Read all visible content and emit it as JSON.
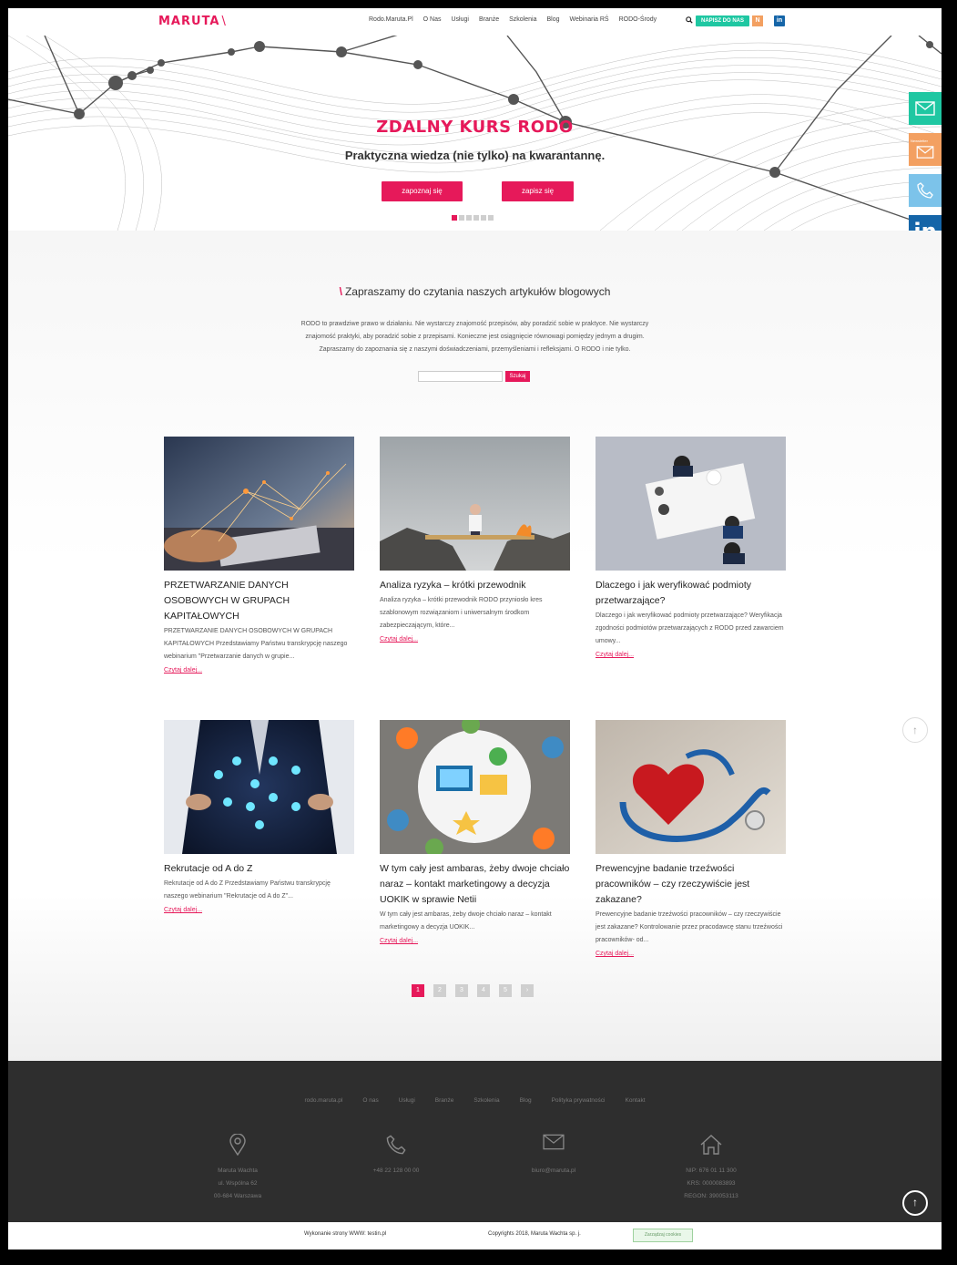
{
  "header": {
    "logo": "MARUTA",
    "nav": [
      "Rodo.Maruta.Pl",
      "O Nas",
      "Usługi",
      "Branże",
      "Szkolenia",
      "Blog",
      "Webinaria RŚ",
      "RODO-Środy"
    ],
    "contact_button": "NAPISZ DO NAS",
    "n_badge": "N",
    "linkedin_badge": "in"
  },
  "hero": {
    "title": "ZDALNY KURS RODO",
    "subtitle": "Praktyczna wiedza (nie tylko) na kwarantannę.",
    "button_1": "zapoznaj się",
    "button_2": "zapisz się",
    "slides_total": 6,
    "slide_active": 1
  },
  "side_widgets": {
    "newsletter_label": "Newsletter",
    "linkedin_label": "in"
  },
  "blog": {
    "heading": "Zapraszamy do czytania naszych artykułów blogowych",
    "intro_1": "RODO to prawdziwe prawo w działaniu. Nie wystarczy znajomość przepisów, aby poradzić sobie w praktyce. Nie wystarczy",
    "intro_2": "znajomość praktyki, aby poradzić sobie z przepisami. Konieczne jest osiągnięcie równowagi pomiędzy jednym a drugim.",
    "intro_3": "Zapraszamy do zapoznania się z naszymi doświadczeniami, przemyśleniami i refleksjami. O RODO i nie tylko.",
    "search_placeholder": "",
    "search_button": "Szukaj"
  },
  "posts": [
    {
      "title": "PRZETWARZANIE DANYCH OSOBOWYCH W GRUPACH KAPITAŁOWYCH",
      "excerpt": "PRZETWARZANIE DANYCH OSOBOWYCH W GRUPACH KAPITAŁOWYCH Przedstawiamy Państwu transkrypcję naszego webinarium \"Przetwarzanie danych w grupie...",
      "more": "Czytaj dalej..."
    },
    {
      "title": "Analiza ryzyka – krótki przewodnik",
      "excerpt": "Analiza ryzyka – krótki przewodnik RODO przyniosło kres szablonowym rozwiązaniom i uniwersalnym środkom zabezpieczającym, które...",
      "more": "Czytaj dalej..."
    },
    {
      "title": "Dlaczego i jak weryfikować podmioty przetwarzające?",
      "excerpt": "Dlaczego i jak weryfikować podmioty przetwarzające? Weryfikacja zgodności podmiotów przetwarzających z RODO przed zawarciem umowy...",
      "more": "Czytaj dalej..."
    },
    {
      "title": "Rekrutacje od A do Z",
      "excerpt": "Rekrutacje od A do Z Przedstawiamy Państwu transkrypcję naszego webinarium \"Rekrutacje od A do Z\"...",
      "more": "Czytaj dalej..."
    },
    {
      "title": "W tym cały jest ambaras, żeby dwoje chciało naraz – kontakt marketingowy a decyzja UOKIK w sprawie Netii",
      "excerpt": "W tym cały jest ambaras, żeby dwoje chciało naraz – kontakt marketingowy a decyzja UOKIK...",
      "more": "Czytaj dalej..."
    },
    {
      "title": "Prewencyjne badanie trzeźwości pracowników – czy rzeczywiście jest zakazane?",
      "excerpt": "Prewencyjne badanie trzeźwości pracowników – czy rzeczywiście jest zakazane? Kontrolowanie przez pracodawcę stanu trzeźwości pracowników- od...",
      "more": "Czytaj dalej..."
    }
  ],
  "pagination": [
    "1",
    "2",
    "3",
    "4",
    "5",
    "›"
  ],
  "footer": {
    "nav": [
      "rodo.maruta.pl",
      "O nas",
      "Usługi",
      "Branże",
      "Szkolenia",
      "Blog",
      "Polityka prywatności",
      "Kontakt"
    ],
    "address": [
      "Maruta Wachta",
      "ul. Wspólna 62",
      "00-684 Warszawa"
    ],
    "phone": "+48 22 128 00 00",
    "email": "biuro@maruta.pl",
    "company": [
      "NIP: 676 01 11 300",
      "KRS: 0000083893",
      "REGON: 390053113"
    ],
    "made_by": "Wykonanie strony WWW: testin.pl",
    "copyright": "Copyrights 2018, Maruta Wachta sp. j.",
    "cookie_button": "Zarządzaj cookies"
  },
  "colors": {
    "accent": "#e6195a",
    "teal": "#1fc7a2",
    "orange": "#f3a061",
    "sky": "#7cc3ea",
    "linkedin": "#1565a8",
    "footer_bg": "#2e2e2e"
  }
}
